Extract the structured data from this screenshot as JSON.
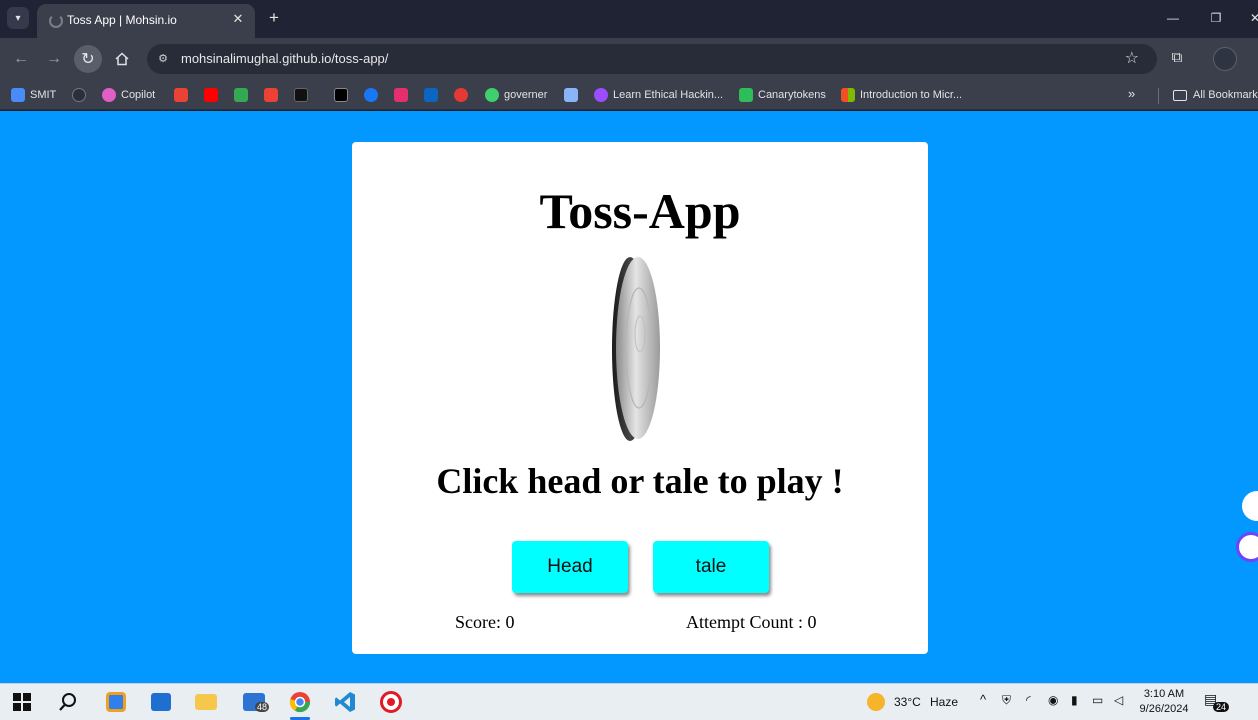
{
  "browser": {
    "tab_title": "Toss App | Mohsin.io",
    "tab_close": "✕",
    "new_tab": "+",
    "url": "mohsinalimughal.github.io/toss-app/",
    "window": {
      "minimize": "—",
      "restore": "❐",
      "close": "✕"
    }
  },
  "bookmarks": {
    "items": [
      {
        "label": "SMIT",
        "color": "#4a8cf7"
      },
      {
        "label": "",
        "color": "#2b2f3a"
      },
      {
        "label": "Copilot",
        "color": "#e05fc4"
      },
      {
        "label": "",
        "color": "#ea4335"
      },
      {
        "label": "",
        "color": "#ff0000"
      },
      {
        "label": "",
        "color": "#34a853"
      },
      {
        "label": "",
        "color": "#ea4335"
      },
      {
        "label": "",
        "color": "#111111"
      },
      {
        "label": "",
        "color": "#000000"
      },
      {
        "label": "",
        "color": "#1877f2"
      },
      {
        "label": "",
        "color": "#e1306c"
      },
      {
        "label": "",
        "color": "#0a66c2"
      },
      {
        "label": "",
        "color": "#e53935"
      },
      {
        "label": "governer",
        "color": "#3ecf6e"
      },
      {
        "label": "",
        "color": "#8ab4f8"
      },
      {
        "label": "Learn Ethical Hackin...",
        "color": "#9b4dff"
      },
      {
        "label": "Canarytokens",
        "color": "#2ebd59"
      },
      {
        "label": "Introduction to Micr...",
        "color": "#f25022"
      }
    ],
    "more": "»",
    "all_bookmarks": "All Bookmarks"
  },
  "app": {
    "title": "Toss-App",
    "prompt": "Click head or tale to play !",
    "head_button": "Head",
    "tale_button": "tale",
    "score_label": "Score: 0",
    "attempt_label": "Attempt Count : 0",
    "background": "#0298ff",
    "button_color": "#00ffff"
  },
  "taskbar": {
    "vscode_badge": "48",
    "weather_temp": "33°C",
    "weather_desc": "Haze",
    "time": "3:10 AM",
    "date": "9/26/2024",
    "notification_count": "24"
  }
}
